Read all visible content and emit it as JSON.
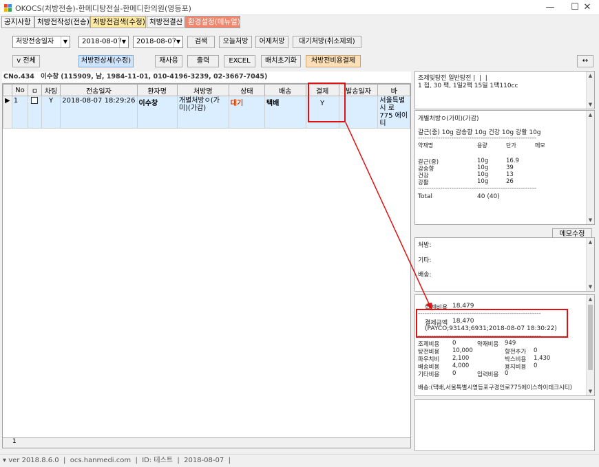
{
  "window": {
    "title": "OKOCS(처방전송)-한메디탕전실-한메디한의원(영등포)",
    "minimize": "—",
    "maximize": "☐",
    "close": "✕"
  },
  "tabs": [
    {
      "label": "공지사항"
    },
    {
      "label": "처방전작성(전송)"
    },
    {
      "label": "처방전검색(수정)"
    },
    {
      "label": "처방전결산"
    },
    {
      "label": "환경설정(메뉴얼)"
    }
  ],
  "search": {
    "date_type": "처방전송일자",
    "date_from": "2018-08-07",
    "date_to": "2018-08-07",
    "search_btn": "검색",
    "today_btn": "오늘처방",
    "yesterday_btn": "어제처방",
    "pending_btn": "대기처방(취소제외)"
  },
  "actions": {
    "all_btn": "v 전체",
    "detail_btn": "처방전상세(수정)",
    "reuse_btn": "재사용",
    "print_btn": "출력",
    "excel_btn": "EXCEL",
    "reset_btn": "배치초기화",
    "pay_btn": "처방전비용결제",
    "expand_btn": "↔"
  },
  "patient_info": {
    "cno": "CNo.434",
    "name": "이수창",
    "detail": "(115909, 남, 1984-11-01, 010-4196-3239, 02-3667-7045)"
  },
  "grid": {
    "columns": [
      "No",
      "ㅁ",
      "차팅",
      "전송일자",
      "환자명",
      "처방명",
      "상태",
      "배송",
      "결제",
      "발송일자",
      "바"
    ],
    "rows": [
      {
        "no": "1",
        "chart": "Y",
        "date": "2018-08-07 18:29:26",
        "patient": "이수창",
        "rx": "개별처방ㅇ(가미)(가감)",
        "status": "대기",
        "delivery": "택배",
        "paid": "Y",
        "sent": "",
        "address": "서울특별시 로 775 에이 티"
      }
    ],
    "footer_no": "1"
  },
  "panel_top": {
    "lines": [
      "조제및탕전 일반탕전 |  |  |",
      "1 첩, 30 팩, 1일2팩 15일 1팩110cc"
    ]
  },
  "panel_rx": {
    "title": "개별처방ㅇ(가미)(가감)",
    "summary": "갈근(중) 10g 감송향 10g 건강 10g 강활 10g",
    "dash": "-----------------------------------------------------",
    "headers": [
      "약재명",
      "용량",
      "단가",
      "메모"
    ],
    "herbs": [
      {
        "name": "갈근(중)",
        "qty": "10g",
        "price": "16.9"
      },
      {
        "name": "감송향",
        "qty": "10g",
        "price": "39"
      },
      {
        "name": "건강",
        "qty": "10g",
        "price": "13"
      },
      {
        "name": "강활",
        "qty": "10g",
        "price": "26"
      }
    ],
    "total_label": "Total",
    "total_value": "40 (40)"
  },
  "memo": {
    "edit_btn": "메모수정",
    "rx_label": "처방:",
    "etc_label": "기타:",
    "delivery_label": "배송:"
  },
  "billing": {
    "total_label": "합계비용",
    "total_value": "18,479",
    "dash": "-------------------------------------------------------",
    "paid_label": "결제금액",
    "paid_value": "18,470",
    "paid_detail": "(PAYCO;93143;6931;2018-08-07 18:30:22)",
    "items": [
      {
        "l1": "조제비용",
        "v1": "0",
        "l2": "약재비용",
        "v2": "949"
      },
      {
        "l1": "탕전비용",
        "v1": "10,000",
        "l2": "향전추가",
        "v2": "0"
      },
      {
        "l1": "파우치비",
        "v1": "2,100",
        "l2": "박스비용",
        "v2": "1,430"
      },
      {
        "l1": "배송비용",
        "v1": "4,000",
        "l2": "용지비용",
        "v2": "0"
      },
      {
        "l1": "기타비용",
        "v1": "0",
        "l2": "입력비용",
        "v2": "0"
      }
    ],
    "address": "배송:(택배,서울특별시영등포구경인로775에이스하이테크시티)"
  },
  "status": {
    "version": "ver 2018.8.6.0",
    "site": "ocs.hanmedi.com",
    "id": "ID: 테스트",
    "date": "2018-08-07"
  },
  "colors": {
    "accent_tab": "#fde9a2",
    "highlight_tab": "#f08870",
    "selected_row": "#dbeeff",
    "annotation_red": "#e01010"
  }
}
